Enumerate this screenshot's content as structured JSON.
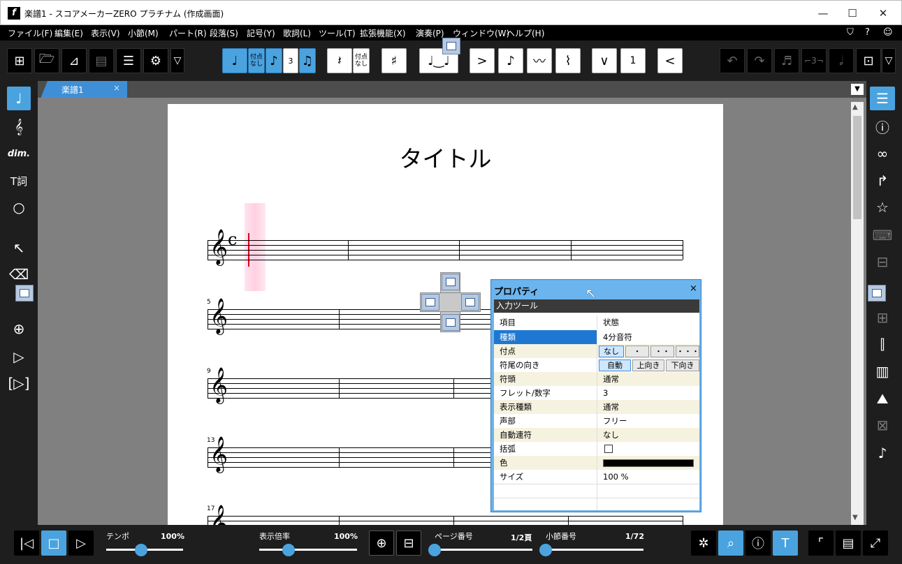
{
  "window": {
    "title": "楽譜1 - スコアメーカーZERO プラチナム (作成画面)",
    "minimize": "—",
    "maximize": "☐",
    "close": "✕"
  },
  "menu": [
    "ファイル(F)",
    "編集(E)",
    "表示(V)",
    "小節(M)",
    "パート(R)",
    "段落(S)",
    "記号(Y)",
    "歌詞(L)",
    "ツール(T)",
    "拡張機能(X)",
    "演奏(P)",
    "ウィンドウ(W)",
    "ヘルプ(H)"
  ],
  "toolbar": {
    "dot_none_1": "付点\nなし",
    "dot_none_2": "付点\nなし",
    "tuplet": "3",
    "count_button": "1"
  },
  "tab": {
    "label": "楽譜1",
    "close": "×"
  },
  "score": {
    "title": "タイトル",
    "measure_numbers": [
      "5",
      "9",
      "13",
      "17"
    ],
    "time_signature": "c"
  },
  "left_tools": [
    "note-input",
    "clef-edit",
    "dynamics",
    "lyrics",
    "shape",
    "select",
    "eraser",
    "loop",
    "zoom",
    "play",
    "play-range"
  ],
  "left_tool_labels": {
    "dim": "dim."
  },
  "properties": {
    "title": "プロパティ",
    "close": "×",
    "section": "入力ツール",
    "header": {
      "key": "項目",
      "value": "状態"
    },
    "rows": [
      {
        "key": "種類",
        "value": "4分音符"
      },
      {
        "key": "付点",
        "value": ""
      },
      {
        "key": "符尾の向き",
        "value": ""
      },
      {
        "key": "符頭",
        "value": "通常"
      },
      {
        "key": "フレット/数字",
        "value": "3"
      },
      {
        "key": "表示種類",
        "value": "通常"
      },
      {
        "key": "声部",
        "value": "フリー"
      },
      {
        "key": "自動連符",
        "value": "なし"
      },
      {
        "key": "括弧",
        "value": ""
      },
      {
        "key": "色",
        "value": ""
      },
      {
        "key": "サイズ",
        "value": "100 %"
      }
    ],
    "dot_options": [
      "なし",
      "・",
      "・・",
      "・・・"
    ],
    "stem_options": [
      "自動",
      "上向き",
      "下向き"
    ],
    "color_value": "#000000"
  },
  "bottom": {
    "tempo_label": "テンポ",
    "tempo_value": "100%",
    "tempo_fraction": 0.45,
    "zoom_label": "表示倍率",
    "zoom_value": "100%",
    "zoom_fraction": 0.3,
    "page_label": "ページ番号",
    "page_value": "1/2頁",
    "page_fraction": 0.0,
    "measure_label": "小節番号",
    "measure_value": "1/72",
    "measure_fraction": 0.0
  },
  "colors": {
    "accent": "#4aa3df",
    "selection": "#1e78d2",
    "panel": "#6bb4ee"
  }
}
